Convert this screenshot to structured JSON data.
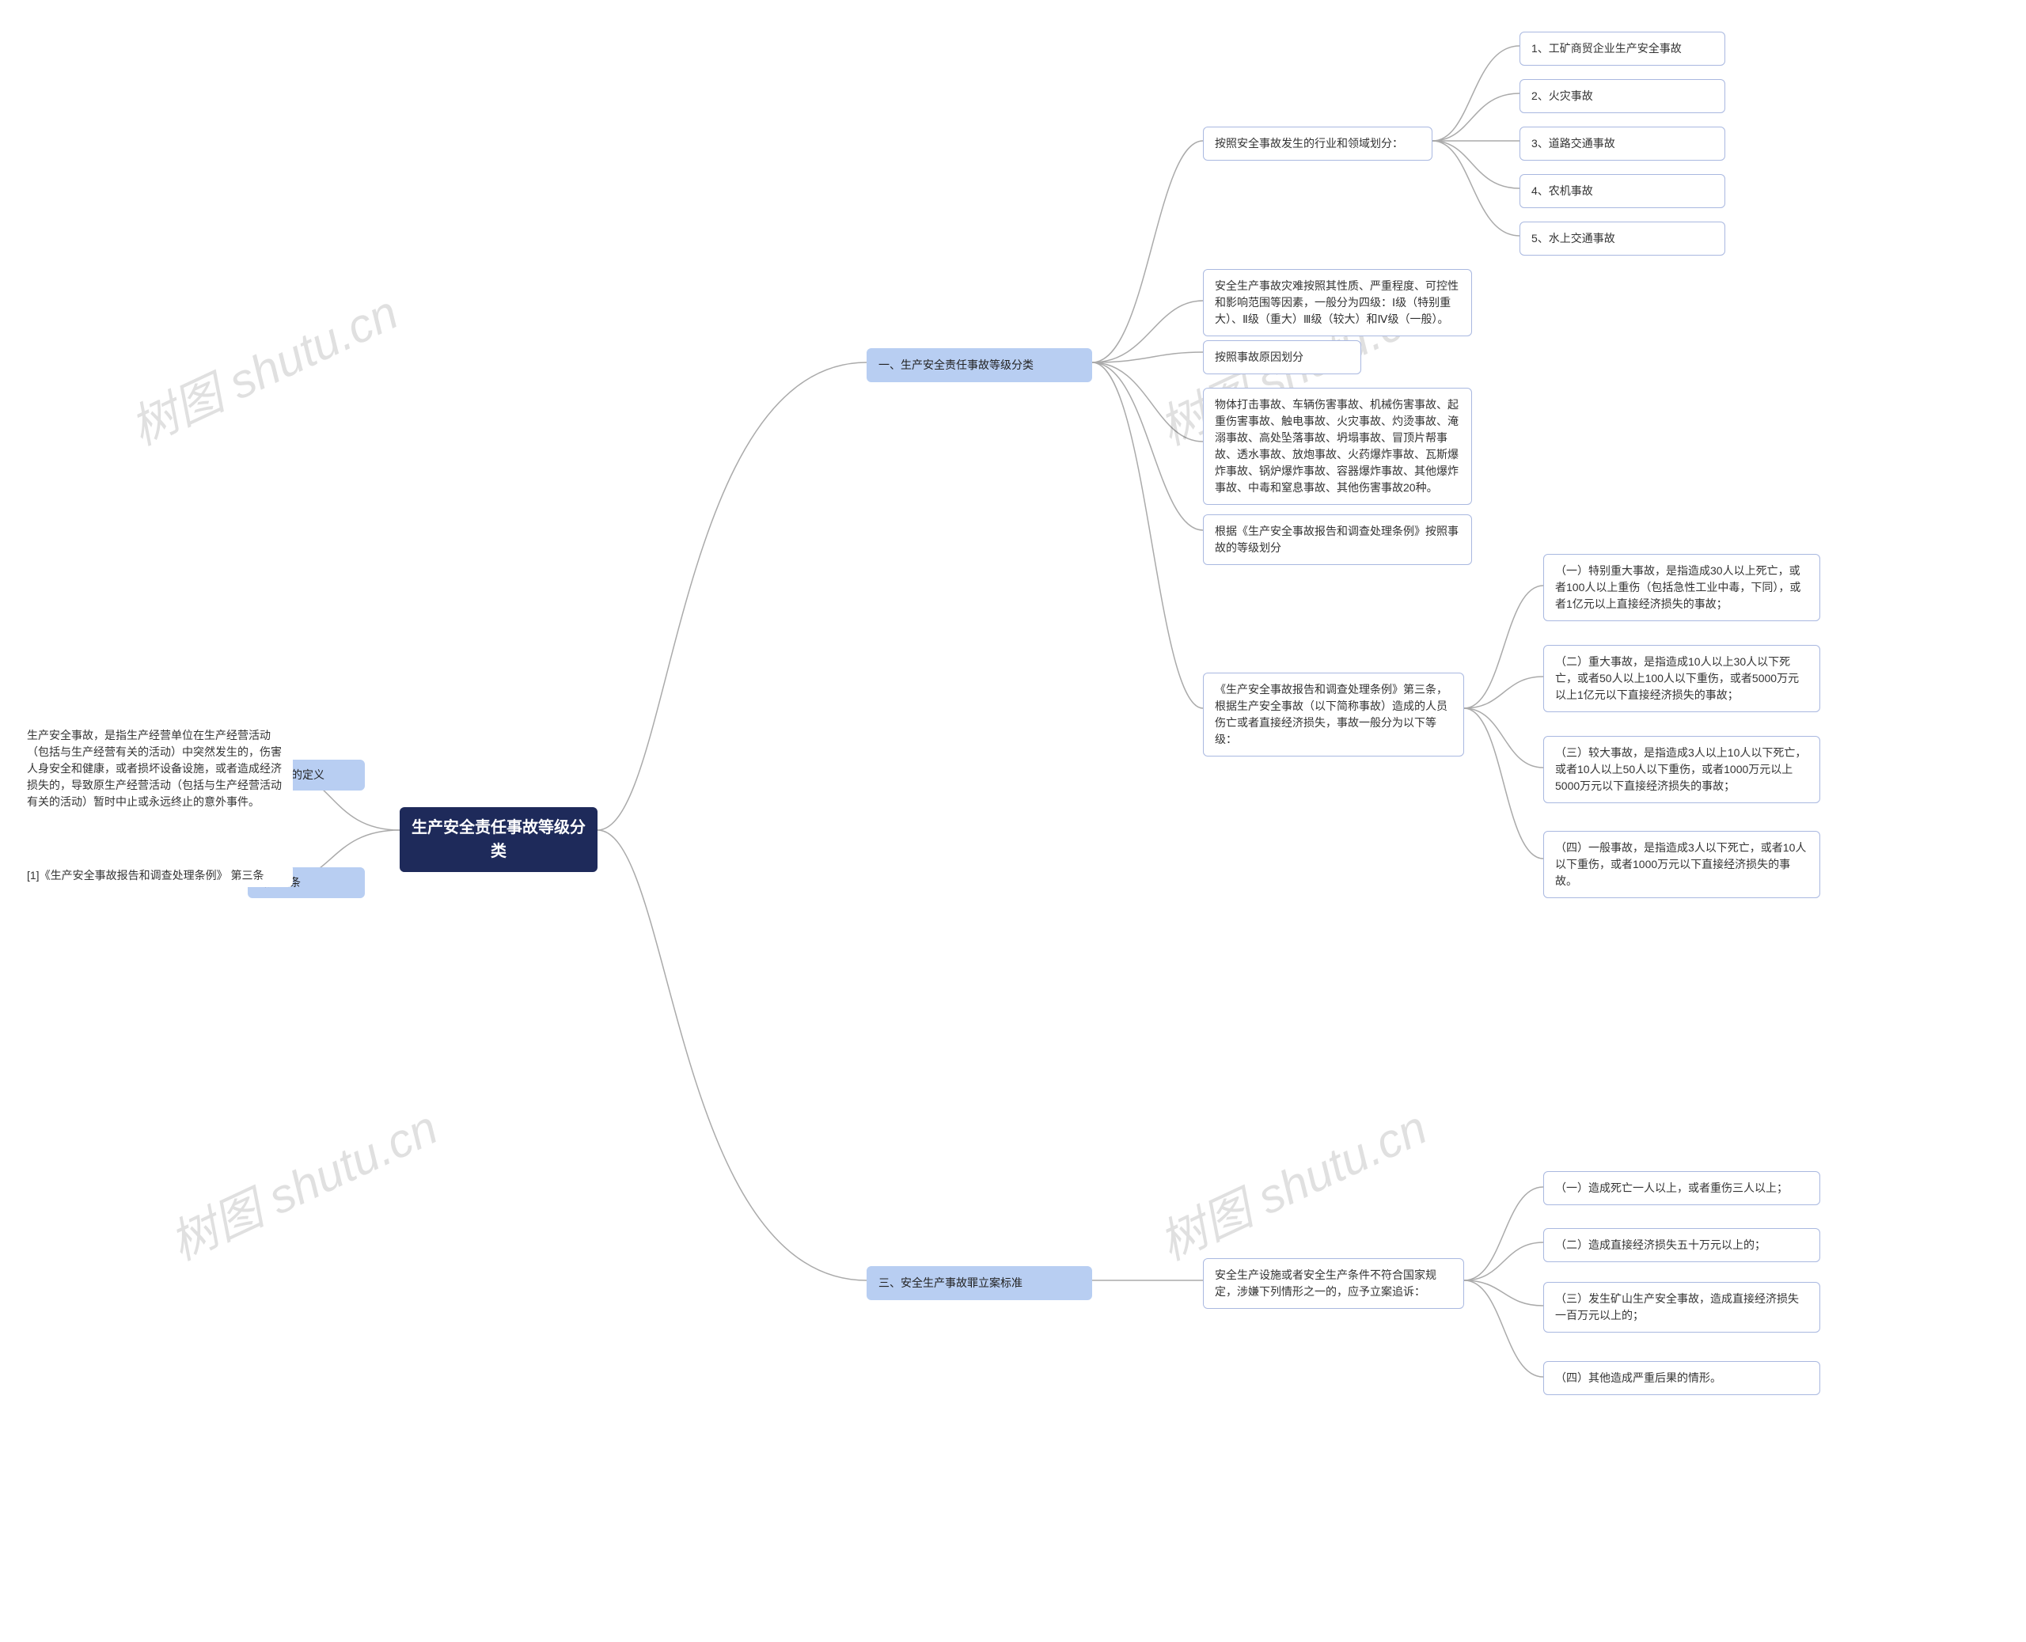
{
  "watermark": "树图 shutu.cn",
  "center": "生产安全责任事故等级分类",
  "branch1": {
    "title": "一、生产安全责任事故等级分类",
    "sub_industry": "按照安全事故发生的行业和领域划分：",
    "industry_items": [
      "1、工矿商贸企业生产安全事故",
      "2、火灾事故",
      "3、道路交通事故",
      "4、农机事故",
      "5、水上交通事故"
    ],
    "four_levels": "安全生产事故灾难按照其性质、严重程度、可控性和影响范围等因素，一般分为四级：Ⅰ级（特别重大）、Ⅱ级（重大）Ⅲ级（较大）和Ⅳ级（一般）。",
    "by_cause": "按照事故原因划分",
    "cause_types": "物体打击事故、车辆伤害事故、机械伤害事故、起重伤害事故、触电事故、火灾事故、灼烫事故、淹溺事故、高处坠落事故、坍塌事故、冒顶片帮事故、透水事故、放炮事故、火药爆炸事故、瓦斯爆炸事故、锅炉爆炸事故、容器爆炸事故、其他爆炸事故、中毒和窒息事故、其他伤害事故20种。",
    "by_level_regulation": "根据《生产安全事故报告和调查处理条例》按照事故的等级划分",
    "regulation_clause": "《生产安全事故报告和调查处理条例》第三条，根据生产安全事故（以下简称事故）造成的人员伤亡或者直接经济损失，事故一般分为以下等级：",
    "levels": [
      "（一）特别重大事故，是指造成30人以上死亡，或者100人以上重伤（包括急性工业中毒，下同），或者1亿元以上直接经济损失的事故；",
      "（二）重大事故，是指造成10人以上30人以下死亡，或者50人以上100人以下重伤，或者5000万元以上1亿元以下直接经济损失的事故；",
      "（三）较大事故，是指造成3人以上10人以下死亡，或者10人以上50人以下重伤，或者1000万元以上5000万元以下直接经济损失的事故；",
      "（四）一般事故，是指造成3人以下死亡，或者10人以下重伤，或者1000万元以下直接经济损失的事故。"
    ]
  },
  "branch2": {
    "title": "二、安全生产事故的定义",
    "definition": "生产安全事故，是指生产经营单位在生产经营活动（包括与生产经营有关的活动）中突然发生的，伤害人身安全和健康，或者损坏设备设施，或者造成经济损失的，导致原生产经营活动（包括与生产经营活动有关的活动）暂时中止或永远终止的意外事件。"
  },
  "branch3": {
    "title": "三、安全生产事故罪立案标准",
    "intro": "安全生产设施或者安全生产条件不符合国家规定，涉嫌下列情形之一的，应予立案追诉：",
    "items": [
      "（一）造成死亡一人以上，或者重伤三人以上；",
      "（二）造成直接经济损失五十万元以上的；",
      "（三）发生矿山生产安全事故，造成直接经济损失一百万元以上的；",
      "（四）其他造成严重后果的情形。"
    ]
  },
  "branch_ref": {
    "title": "引用法条",
    "ref": "[1]《生产安全事故报告和调查处理条例》 第三条"
  }
}
